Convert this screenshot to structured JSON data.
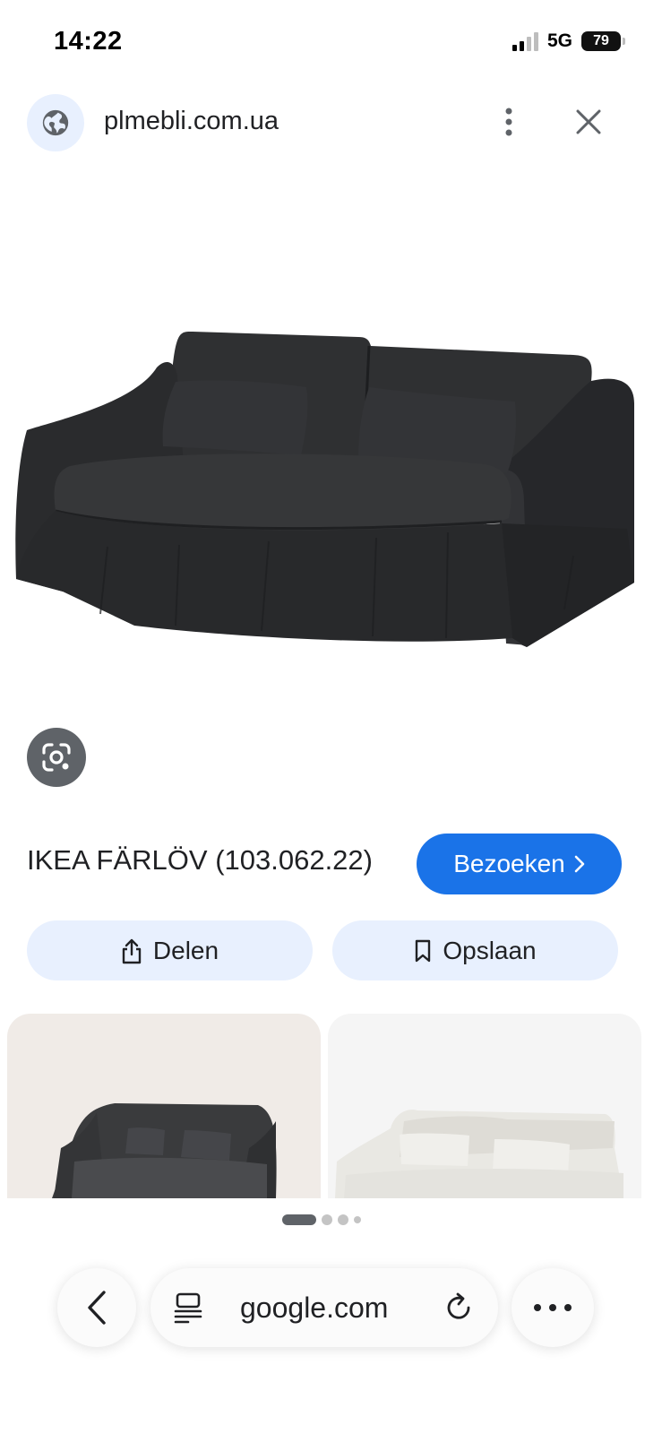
{
  "status_bar": {
    "time": "14:22",
    "network": "5G",
    "battery": "79",
    "icons": [
      "signal-icon",
      "battery-icon"
    ]
  },
  "source": {
    "domain": "plmebli.com.ua",
    "icons": [
      "globe-icon",
      "more-vert-icon",
      "close-icon"
    ]
  },
  "product": {
    "title": "IKEA FÄRLÖV (103.062.22)",
    "visit_label": "Bezoeken",
    "visit_color": "#1a73e8"
  },
  "actions": {
    "share_label": "Delen",
    "save_label": "Opslaan",
    "icons": [
      "share-icon",
      "bookmark-icon"
    ]
  },
  "lens": {
    "icon": "lens-icon"
  },
  "pager": {
    "active_index": 0,
    "count": 4
  },
  "browser": {
    "url": "google.com",
    "icons": [
      "back-icon",
      "tabs-icon",
      "reload-icon",
      "more-horiz-icon"
    ]
  },
  "colors": {
    "accent": "#1a73e8",
    "chip_bg": "#e8f0fe",
    "sofa": "#2b2c2e"
  }
}
